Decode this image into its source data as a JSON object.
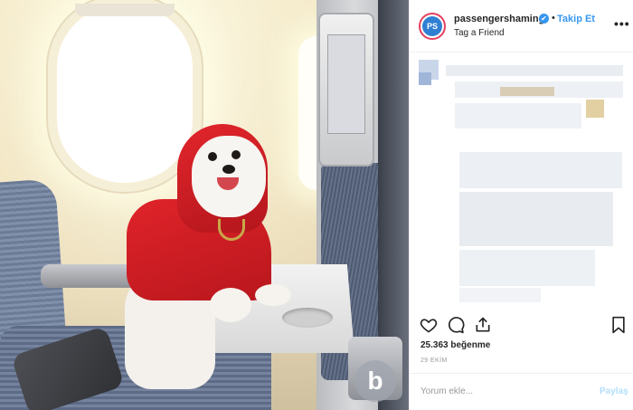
{
  "header": {
    "avatar_text": "PS",
    "username": "passengershaming",
    "verified_mark": "✔",
    "separator": "•",
    "follow_label": "Takip Et",
    "subtitle": "Tag a Friend",
    "more_label": "•••"
  },
  "icons": {
    "like": "heart-icon",
    "comment": "comment-icon",
    "share": "share-icon",
    "save": "bookmark-icon"
  },
  "stats": {
    "likes": "25.363 beğenme",
    "date": "29 EKİM"
  },
  "comment": {
    "placeholder": "Yorum ekle...",
    "post_label": "Paylaş"
  },
  "watermark": "b",
  "colors": {
    "accent": "#3897f0",
    "text": "#262626",
    "muted": "#999999",
    "hoodie": "#d7202a"
  }
}
